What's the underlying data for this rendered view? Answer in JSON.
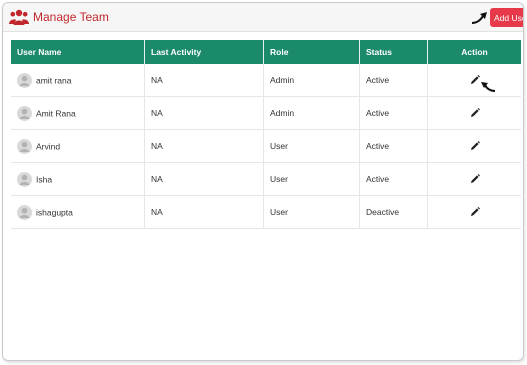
{
  "header": {
    "title": "Manage Team",
    "team_icon": "users-group-icon",
    "add_button_label": "Add User",
    "add_arrow_icon": "curved-arrow-icon"
  },
  "colors": {
    "title": "#c0272d",
    "add_button": "#e8394a",
    "table_header": "#1b8a6b"
  },
  "table": {
    "columns": [
      "User Name",
      "Last Activity",
      "Role",
      "Status",
      "Action"
    ],
    "rows": [
      {
        "name": "amit rana",
        "last_activity": "NA",
        "role": "Admin",
        "status": "Active",
        "action_icon": "pencil-edit-icon"
      },
      {
        "name": "Amit Rana",
        "last_activity": "NA",
        "role": "Admin",
        "status": "Active",
        "action_icon": "pencil-edit-icon"
      },
      {
        "name": "Arvind",
        "last_activity": "NA",
        "role": "User",
        "status": "Active",
        "action_icon": "pencil-edit-icon"
      },
      {
        "name": "Isha",
        "last_activity": "NA",
        "role": "User",
        "status": "Active",
        "action_icon": "pencil-edit-icon"
      },
      {
        "name": "ishagupta",
        "last_activity": "NA",
        "role": "User",
        "status": "Deactive",
        "action_icon": "pencil-edit-icon"
      }
    ]
  }
}
